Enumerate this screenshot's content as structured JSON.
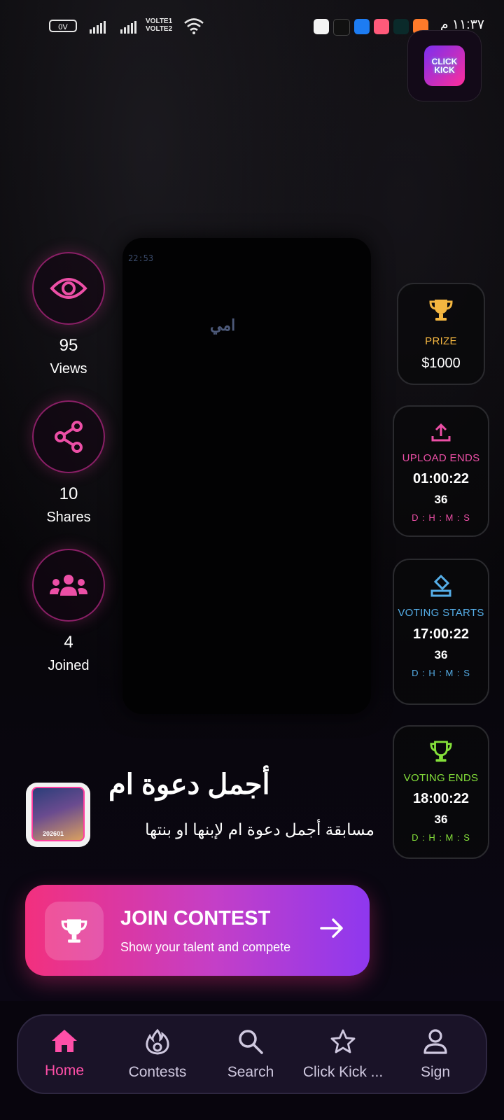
{
  "status_bar": {
    "battery": "0V",
    "volte": [
      "VOLTE1",
      "VOLTE2"
    ],
    "time": "١١:٣٧ م"
  },
  "app_logo": {
    "line1": "CLICK",
    "line2": "KICK"
  },
  "stats": [
    {
      "icon": "eye-icon",
      "value": "95",
      "label": "Views"
    },
    {
      "icon": "share-icon",
      "value": "10",
      "label": "Shares"
    },
    {
      "icon": "group-icon",
      "value": "4",
      "label": "Joined"
    }
  ],
  "prize": {
    "icon": "trophy-icon",
    "title": "PRIZE",
    "value": "$1000",
    "color": "#f4b640"
  },
  "timers": [
    {
      "icon": "upload-icon",
      "title": "UPLOAD ENDS",
      "time": "01:00:22",
      "days": "36",
      "unit": "D : H : M : S",
      "color": "#ec4fa6"
    },
    {
      "icon": "ballot-icon",
      "title": "VOTING STARTS",
      "time": "17:00:22",
      "days": "36",
      "unit": "D : H : M : S",
      "color": "#55aee8"
    },
    {
      "icon": "trophy-icon",
      "title": "VOTING ENDS",
      "time": "18:00:22",
      "days": "36",
      "unit": "D : H : M : S",
      "color": "#84e03a"
    }
  ],
  "contest": {
    "thumb_year": "202601",
    "title": "أجمل دعوة ام",
    "description": "مسابقة أجمل دعوة ام لإبنها او بنتها"
  },
  "join_button": {
    "title": "JOIN CONTEST",
    "subtitle": "Show your talent and compete"
  },
  "nav": [
    {
      "icon": "home-icon",
      "label": "Home",
      "active": true
    },
    {
      "icon": "fire-icon",
      "label": "Contests",
      "active": false
    },
    {
      "icon": "search-icon",
      "label": "Search",
      "active": false
    },
    {
      "icon": "star-icon",
      "label": "Click Kick ...",
      "active": false
    },
    {
      "icon": "user-icon",
      "label": "Sign",
      "active": false
    }
  ],
  "colors": {
    "accent": "#ec4fa6",
    "nav_bg": "#1a1328",
    "join_start": "#f2307e",
    "join_end": "#8e38ef"
  }
}
